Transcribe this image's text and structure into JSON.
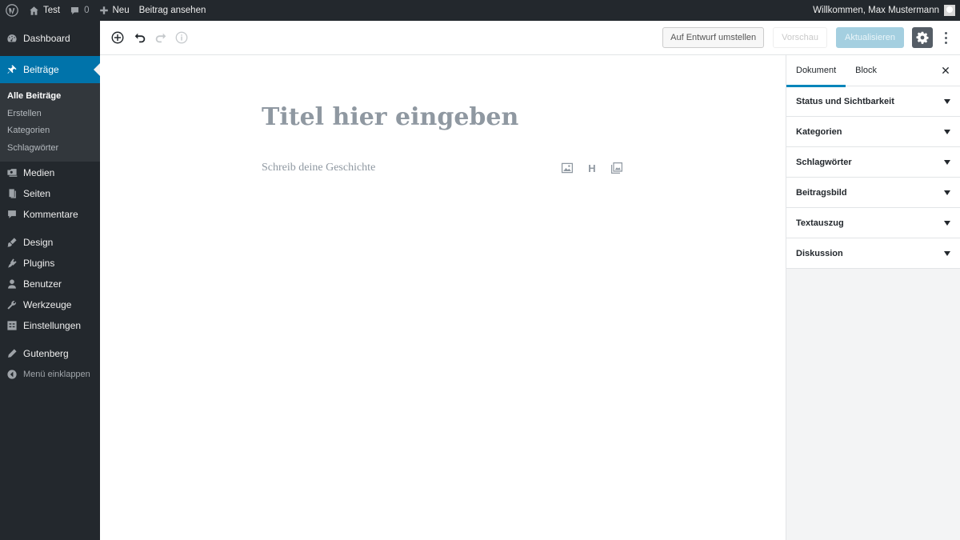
{
  "adminbar": {
    "site_name": "Test",
    "comments_count": "0",
    "new_label": "Neu",
    "view_post_label": "Beitrag ansehen",
    "greeting": "Willkommen, Max Mustermann"
  },
  "menu": {
    "dashboard": "Dashboard",
    "posts": "Beiträge",
    "posts_sub": [
      "Alle Beiträge",
      "Erstellen",
      "Kategorien",
      "Schlagwörter"
    ],
    "media": "Medien",
    "pages": "Seiten",
    "comments": "Kommentare",
    "design": "Design",
    "plugins": "Plugins",
    "users": "Benutzer",
    "tools": "Werkzeuge",
    "settings": "Einstellungen",
    "gutenberg": "Gutenberg",
    "collapse": "Menü einklappen"
  },
  "toolbar": {
    "save_draft": "Auf Entwurf umstellen",
    "preview": "Vorschau",
    "update": "Aktualisieren"
  },
  "editor": {
    "title_placeholder": "Titel hier eingeben",
    "block_placeholder": "Schreib deine Geschichte",
    "heading_shortcut": "H"
  },
  "sidebar": {
    "tabs": [
      "Dokument",
      "Block"
    ],
    "panels": [
      "Status und Sichtbarkeit",
      "Kategorien",
      "Schlagwörter",
      "Beitragsbild",
      "Textauszug",
      "Diskussion"
    ]
  },
  "colors": {
    "admin_dark": "#23282d",
    "admin_sub": "#32373c",
    "accent": "#0073aa",
    "primary_disabled": "#a4cfe0",
    "placeholder_text": "#8f98a1"
  },
  "icons": [
    "wordpress-logo-icon",
    "home-icon",
    "comment-icon",
    "plus-icon",
    "dashboard-icon",
    "pin-icon",
    "media-icon",
    "pages-icon",
    "comments-icon",
    "brush-icon",
    "plugin-icon",
    "user-icon",
    "wrench-icon",
    "settings-grid-icon",
    "pencil-icon",
    "collapse-icon",
    "add-block-icon",
    "undo-icon",
    "redo-icon",
    "info-icon",
    "gear-icon",
    "more-vertical-icon",
    "close-icon",
    "image-icon",
    "gallery-icon"
  ]
}
